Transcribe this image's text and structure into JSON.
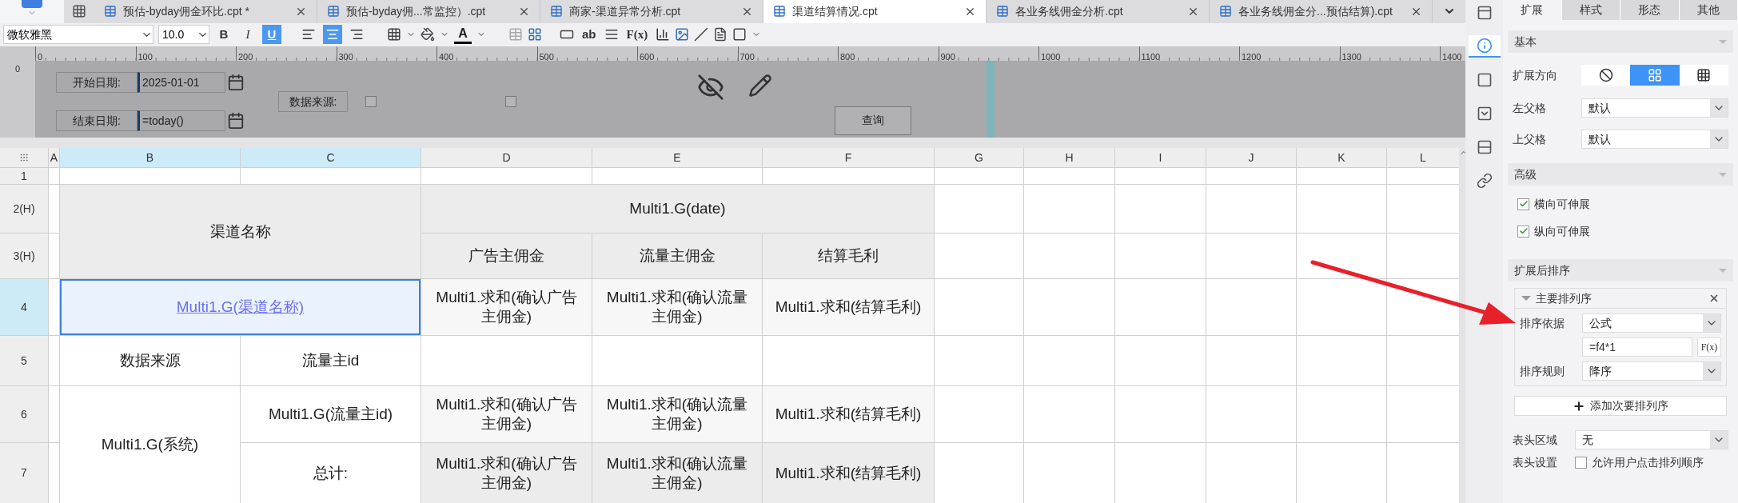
{
  "tabs": [
    {
      "label": "预估-byday佣金环比.cpt *",
      "selected": false
    },
    {
      "label": "预估-byday佣...常监控）.cpt",
      "selected": false
    },
    {
      "label": "商家-渠道异常分析.cpt",
      "selected": false
    },
    {
      "label": "渠道结算情况.cpt",
      "selected": true
    },
    {
      "label": "各业务线佣金分析.cpt",
      "selected": false
    },
    {
      "label": "各业务线佣金分...预估结算).cpt",
      "selected": false
    }
  ],
  "toolbar": {
    "font": "微软雅黑",
    "font_size": "10.0",
    "styles": [
      {
        "label": "B",
        "selected": false
      },
      {
        "label": "I",
        "selected": false
      },
      {
        "label": "U",
        "selected": true
      }
    ],
    "aligns": [
      {
        "selected": false
      },
      {
        "selected": true
      },
      {
        "selected": false
      }
    ],
    "font_color_label": "A",
    "text_label": "ab",
    "formula_label": "F(x)"
  },
  "ruler": {
    "ticks": [
      "0",
      "100",
      "200",
      "300",
      "400",
      "500",
      "600",
      "700",
      "800",
      "900",
      "1000",
      "1100",
      "1200",
      "1300",
      "1400"
    ],
    "vertical_tick": "0"
  },
  "parameters": {
    "dates": [
      {
        "label": "开始日期:",
        "value": "2025-01-01"
      },
      {
        "label": "结束日期:",
        "value": "=today()"
      }
    ],
    "source": {
      "label": "数据来源:",
      "options": [
        {
          "checked": false
        },
        {
          "checked": false
        }
      ]
    },
    "query_button": "查询"
  },
  "sheet": {
    "columns": [
      {
        "label": "A",
        "selected": false
      },
      {
        "label": "B",
        "selected": true
      },
      {
        "label": "C",
        "selected": true
      },
      {
        "label": "D",
        "selected": false
      },
      {
        "label": "E",
        "selected": false
      },
      {
        "label": "F",
        "selected": false
      },
      {
        "label": "G",
        "selected": false
      },
      {
        "label": "H",
        "selected": false
      },
      {
        "label": "I",
        "selected": false
      },
      {
        "label": "J",
        "selected": false
      },
      {
        "label": "K",
        "selected": false
      },
      {
        "label": "L",
        "selected": false
      }
    ],
    "rows": [
      {
        "label": "1",
        "selected": false
      },
      {
        "label": "2(H)",
        "selected": false
      },
      {
        "label": "3(H)",
        "selected": false
      },
      {
        "label": "4",
        "selected": true
      },
      {
        "label": "5",
        "selected": false
      },
      {
        "label": "6",
        "selected": false
      },
      {
        "label": "7",
        "selected": false
      }
    ],
    "cells": [
      {
        "kind": "header",
        "text": "渠道名称",
        "selected": false
      },
      {
        "kind": "header",
        "text": "Multi1.G(date)",
        "selected": false
      },
      {
        "kind": "header",
        "text": "广告主佣金",
        "selected": false
      },
      {
        "kind": "header",
        "text": "流量主佣金",
        "selected": false
      },
      {
        "kind": "header",
        "text": "结算毛利",
        "selected": false
      },
      {
        "kind": "link",
        "text": "Multi1.G(渠道名称)",
        "selected": true
      },
      {
        "kind": "value",
        "text": "Multi1.求和(确认广告主佣金)",
        "selected": false
      },
      {
        "kind": "value",
        "text": "Multi1.求和(确认流量主佣金)",
        "selected": false
      },
      {
        "kind": "value",
        "text": "Multi1.求和(结算毛利)",
        "selected": false
      },
      {
        "kind": "label",
        "text": "数据来源",
        "selected": false
      },
      {
        "kind": "label",
        "text": "流量主id",
        "selected": false
      },
      {
        "kind": "label",
        "text": "Multi1.G(系统)",
        "selected": false
      },
      {
        "kind": "label",
        "text": "Multi1.G(流量主id)",
        "selected": false
      },
      {
        "kind": "value",
        "text": "Multi1.求和(确认广告主佣金)",
        "selected": false
      },
      {
        "kind": "value",
        "text": "Multi1.求和(确认流量主佣金)",
        "selected": false
      },
      {
        "kind": "value",
        "text": "Multi1.求和(结算毛利)",
        "selected": false
      },
      {
        "kind": "label",
        "text": "总计:",
        "selected": false
      },
      {
        "kind": "total",
        "text": "Multi1.求和(确认广告主佣金)",
        "selected": false
      },
      {
        "kind": "total",
        "text": "Multi1.求和(确认流量主佣金)",
        "selected": false
      },
      {
        "kind": "total",
        "text": "Multi1.求和(结算毛利)",
        "selected": false
      }
    ]
  },
  "panel": {
    "rail": [
      {
        "selected": false
      },
      {
        "selected": true
      },
      {
        "selected": false
      },
      {
        "selected": false
      },
      {
        "selected": false
      },
      {
        "selected": false
      }
    ],
    "tabs": [
      {
        "label": "扩展",
        "selected": true
      },
      {
        "label": "样式",
        "selected": false
      },
      {
        "label": "形态",
        "selected": false
      },
      {
        "label": "其他",
        "selected": false
      }
    ],
    "basic": {
      "title": "基本",
      "direction": {
        "label": "扩展方向",
        "options": [
          {
            "selected": false
          },
          {
            "selected": true
          },
          {
            "selected": false
          }
        ]
      },
      "fields": [
        {
          "label": "左父格",
          "value": "默认"
        },
        {
          "label": "上父格",
          "value": "默认"
        }
      ]
    },
    "advanced": {
      "title": "高级",
      "options": [
        {
          "label": "横向可伸展",
          "checked": true
        },
        {
          "label": "纵向可伸展",
          "checked": true
        }
      ]
    },
    "sorting": {
      "title": "扩展后排序",
      "primary": {
        "title": "主要排列序",
        "basis_label": "排序依据",
        "basis": "公式",
        "formula": "=f4*1",
        "formula_button": "F(x)",
        "rule_label": "排序规则",
        "rule": "降序"
      },
      "add_button": "添加次要排列序",
      "header_area": {
        "label": "表头区域",
        "value": "无"
      },
      "header_setting": {
        "label": "表头设置",
        "option": "允许用户点击排列顺序",
        "checked": false
      }
    }
  }
}
